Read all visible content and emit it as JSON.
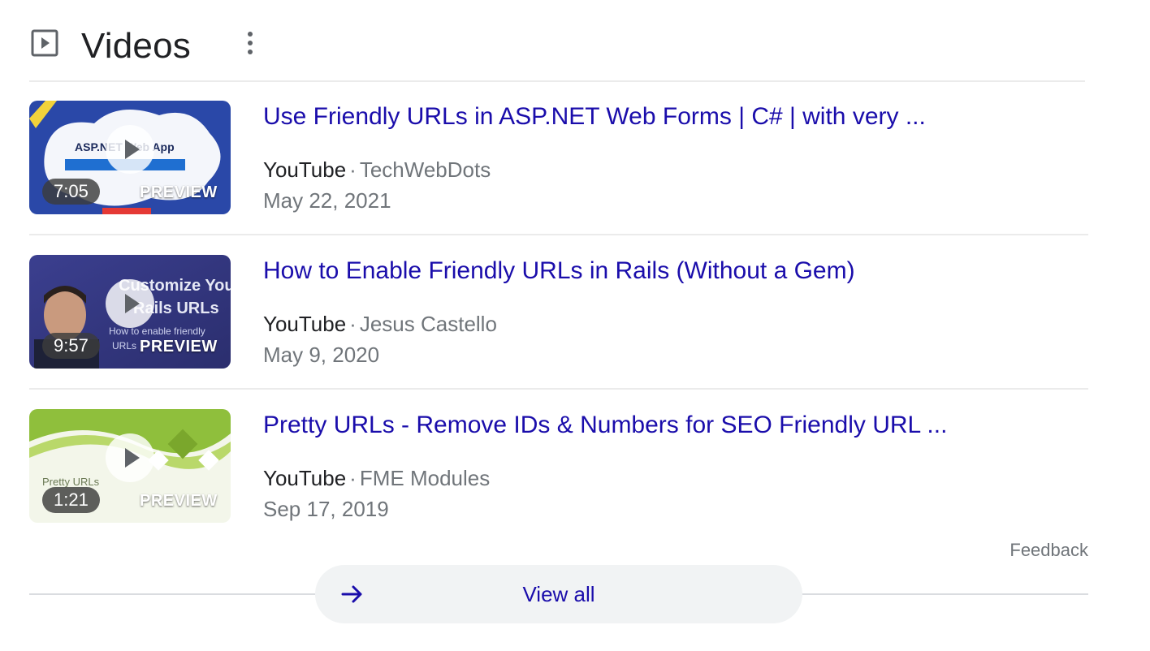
{
  "header": {
    "title": "Videos",
    "icon": "video-play-icon",
    "menu_icon": "more-vert-icon"
  },
  "results": [
    {
      "title": "Use Friendly URLs in ASP.NET Web Forms | C# | with very ...",
      "source": "YouTube",
      "separator": "·",
      "channel": "TechWebDots",
      "date": "May 22, 2021",
      "duration": "7:05",
      "preview_label": "PREVIEW",
      "thumb_text": [
        "ASP.NET Web App"
      ]
    },
    {
      "title": "How to Enable Friendly URLs in Rails (Without a Gem)",
      "source": "YouTube",
      "separator": "·",
      "channel": "Jesus Castello",
      "date": "May 9, 2020",
      "duration": "9:57",
      "preview_label": "PREVIEW",
      "thumb_text": [
        "Customize Your",
        "Rails URLs",
        "How to enable friendly",
        "URLs"
      ]
    },
    {
      "title": "Pretty URLs - Remove IDs & Numbers for SEO Friendly URL ...",
      "source": "YouTube",
      "separator": "·",
      "channel": "FME Modules",
      "date": "Sep 17, 2019",
      "duration": "1:21",
      "preview_label": "PREVIEW",
      "thumb_text": [
        "Pretty URLs"
      ]
    }
  ],
  "footer": {
    "feedback": "Feedback",
    "view_all": "View all",
    "arrow_icon": "arrow-right-icon"
  },
  "colors": {
    "link": "#1a0dab",
    "text": "#202124",
    "muted": "#70757a",
    "button_bg": "#f1f3f4"
  }
}
